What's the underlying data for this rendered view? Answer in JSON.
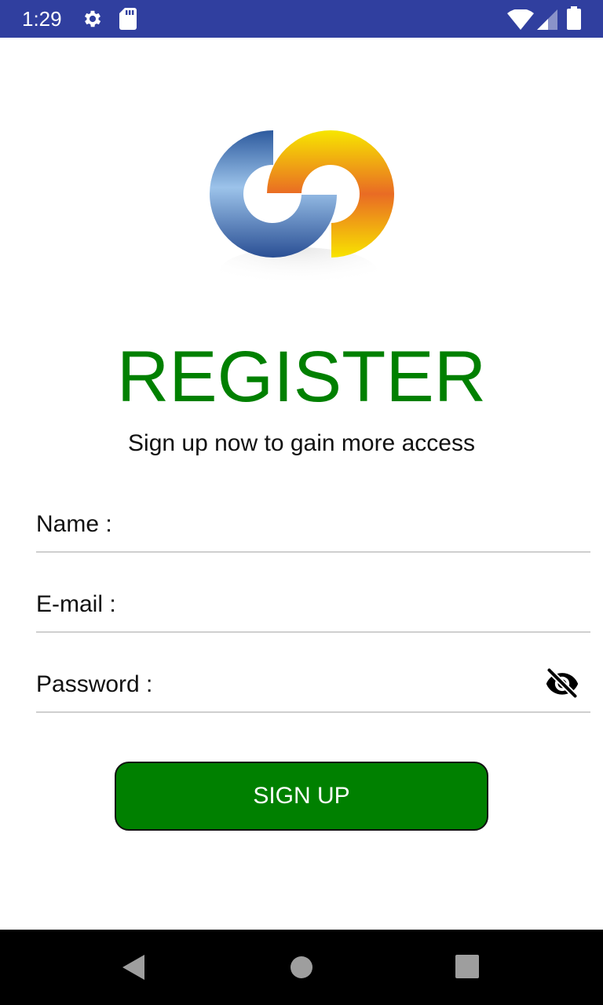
{
  "status_bar": {
    "time": "1:29",
    "icons": [
      "settings-gear-icon",
      "sd-card-icon",
      "wifi-icon",
      "cell-signal-icon",
      "battery-icon"
    ],
    "color": "#303F9F"
  },
  "logo": {
    "icon": "circular-arrows-logo"
  },
  "header": {
    "title": "REGISTER",
    "subtitle": "Sign up now to gain more access",
    "title_color": "#008000"
  },
  "form": {
    "name_label": "Name :",
    "name_value": "",
    "email_label": "E-mail :",
    "email_value": "",
    "password_label": "Password :",
    "password_value": "",
    "password_toggle_icon": "eye-off-icon"
  },
  "actions": {
    "signup_label": "SIGN UP",
    "signup_color": "#008000"
  },
  "nav_bar": {
    "icons": [
      "back-triangle-icon",
      "home-circle-icon",
      "recents-square-icon"
    ]
  }
}
